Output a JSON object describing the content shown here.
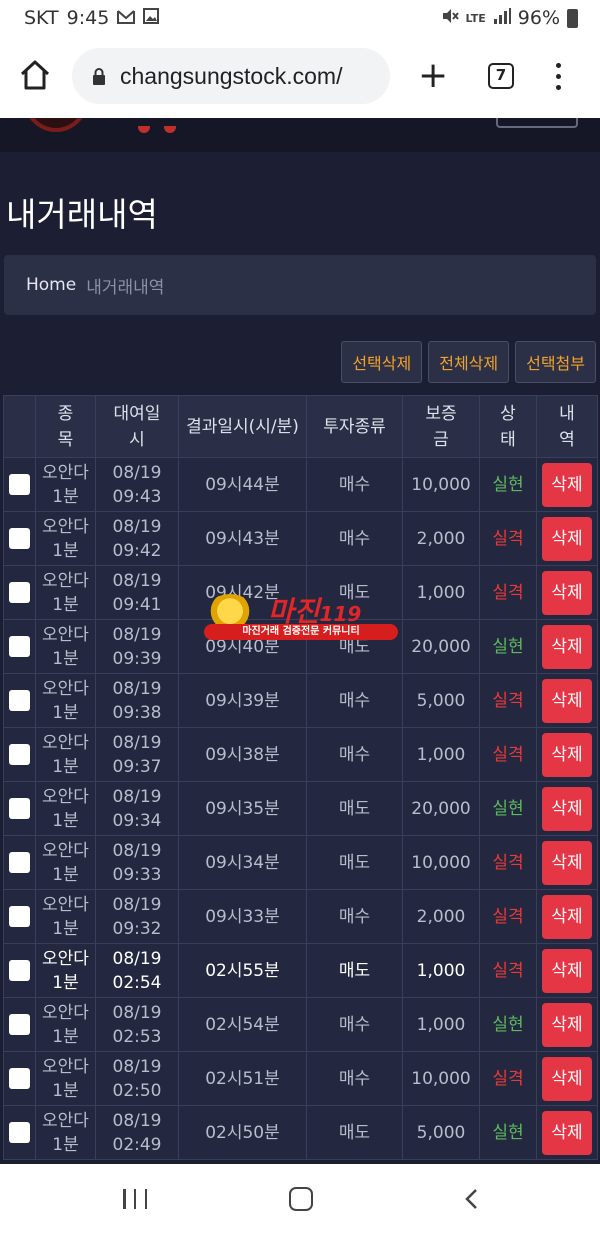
{
  "status_bar": {
    "carrier": "SKT",
    "time": "9:45",
    "network": "LTE",
    "battery": "96%",
    "icons": [
      "gmail-icon",
      "image-icon",
      "mute-icon",
      "signal-icon",
      "battery-icon"
    ]
  },
  "browser": {
    "url": "changsungstock.com/",
    "tab_count": "7"
  },
  "page": {
    "title": "내거래내역",
    "breadcrumb": {
      "home": "Home",
      "current": "내거래내역"
    },
    "actions": {
      "delete_selected": "선택삭제",
      "delete_all": "전체삭제",
      "attach_selected": "선택첨부"
    }
  },
  "watermark": {
    "name": "마진",
    "suffix": "119",
    "tagline": "마진거래 검증전문 커뮤니티"
  },
  "table": {
    "headers": {
      "item": "종목",
      "rent_date": "대여일시",
      "result_date": "결과일시(시/분)",
      "invest_type": "투자종류",
      "deposit": "보증금",
      "status": "상태",
      "history": "내역"
    },
    "rows": [
      {
        "item": "오안다\n1분",
        "date": "08/19\n09:43",
        "result": "09시44분",
        "type": "매수",
        "amount": "10,000",
        "status": "실현",
        "action": "삭제",
        "outcome": "win",
        "bright": false
      },
      {
        "item": "오안다\n1분",
        "date": "08/19\n09:42",
        "result": "09시43분",
        "type": "매수",
        "amount": "2,000",
        "status": "실격",
        "action": "삭제",
        "outcome": "lose",
        "bright": false
      },
      {
        "item": "오안다\n1분",
        "date": "08/19\n09:41",
        "result": "09시42분",
        "type": "매도",
        "amount": "1,000",
        "status": "실격",
        "action": "삭제",
        "outcome": "lose",
        "bright": false
      },
      {
        "item": "오안다\n1분",
        "date": "08/19\n09:39",
        "result": "09시40분",
        "type": "매도",
        "amount": "20,000",
        "status": "실현",
        "action": "삭제",
        "outcome": "win",
        "bright": false
      },
      {
        "item": "오안다\n1분",
        "date": "08/19\n09:38",
        "result": "09시39분",
        "type": "매수",
        "amount": "5,000",
        "status": "실격",
        "action": "삭제",
        "outcome": "lose",
        "bright": false
      },
      {
        "item": "오안다\n1분",
        "date": "08/19\n09:37",
        "result": "09시38분",
        "type": "매수",
        "amount": "1,000",
        "status": "실격",
        "action": "삭제",
        "outcome": "lose",
        "bright": false
      },
      {
        "item": "오안다\n1분",
        "date": "08/19\n09:34",
        "result": "09시35분",
        "type": "매도",
        "amount": "20,000",
        "status": "실현",
        "action": "삭제",
        "outcome": "win",
        "bright": false
      },
      {
        "item": "오안다\n1분",
        "date": "08/19\n09:33",
        "result": "09시34분",
        "type": "매도",
        "amount": "10,000",
        "status": "실격",
        "action": "삭제",
        "outcome": "lose",
        "bright": false
      },
      {
        "item": "오안다\n1분",
        "date": "08/19\n09:32",
        "result": "09시33분",
        "type": "매수",
        "amount": "2,000",
        "status": "실격",
        "action": "삭제",
        "outcome": "lose",
        "bright": false
      },
      {
        "item": "오안다\n1분",
        "date": "08/19\n02:54",
        "result": "02시55분",
        "type": "매도",
        "amount": "1,000",
        "status": "실격",
        "action": "삭제",
        "outcome": "lose",
        "bright": true
      },
      {
        "item": "오안다\n1분",
        "date": "08/19\n02:53",
        "result": "02시54분",
        "type": "매수",
        "amount": "1,000",
        "status": "실현",
        "action": "삭제",
        "outcome": "win",
        "bright": false
      },
      {
        "item": "오안다\n1분",
        "date": "08/19\n02:50",
        "result": "02시51분",
        "type": "매수",
        "amount": "10,000",
        "status": "실격",
        "action": "삭제",
        "outcome": "lose",
        "bright": false
      },
      {
        "item": "오안다\n1분",
        "date": "08/19\n02:49",
        "result": "02시50분",
        "type": "매도",
        "amount": "5,000",
        "status": "실현",
        "action": "삭제",
        "outcome": "win",
        "bright": false
      }
    ]
  },
  "colors": {
    "page_bg": "#1c1f34",
    "win": "#5fb95f",
    "lose": "#e53b3b",
    "accent_orange": "#f0a22c",
    "delete_red": "#e53645"
  }
}
